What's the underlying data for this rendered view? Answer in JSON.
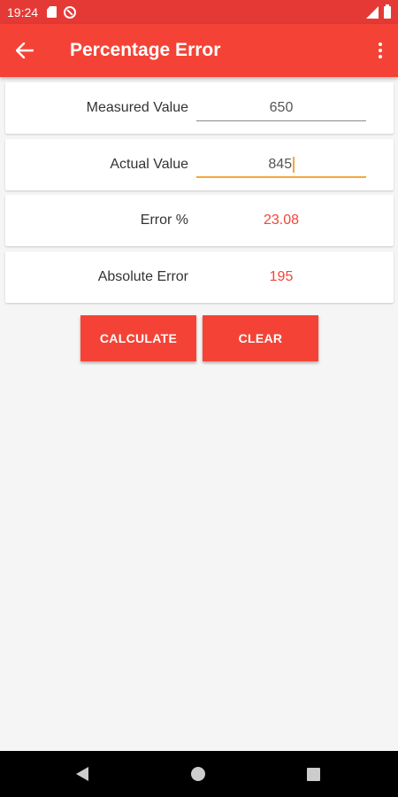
{
  "status_bar": {
    "time": "19:24",
    "icons": [
      "sd-card-icon",
      "do-not-disturb-icon",
      "signal-icon",
      "battery-icon"
    ]
  },
  "app_bar": {
    "title": "Percentage Error",
    "color": "#f44336"
  },
  "form": {
    "measured": {
      "label": "Measured Value",
      "value": "650"
    },
    "actual": {
      "label": "Actual Value",
      "value": "845"
    },
    "error_percent": {
      "label": "Error %",
      "value": "23.08"
    },
    "absolute_error": {
      "label": "Absolute Error",
      "value": "195"
    }
  },
  "buttons": {
    "calculate": "CALCULATE",
    "clear": "CLEAR"
  },
  "colors": {
    "accent": "#f44336",
    "status_bar": "#e53935",
    "focus": "#f4a836"
  }
}
